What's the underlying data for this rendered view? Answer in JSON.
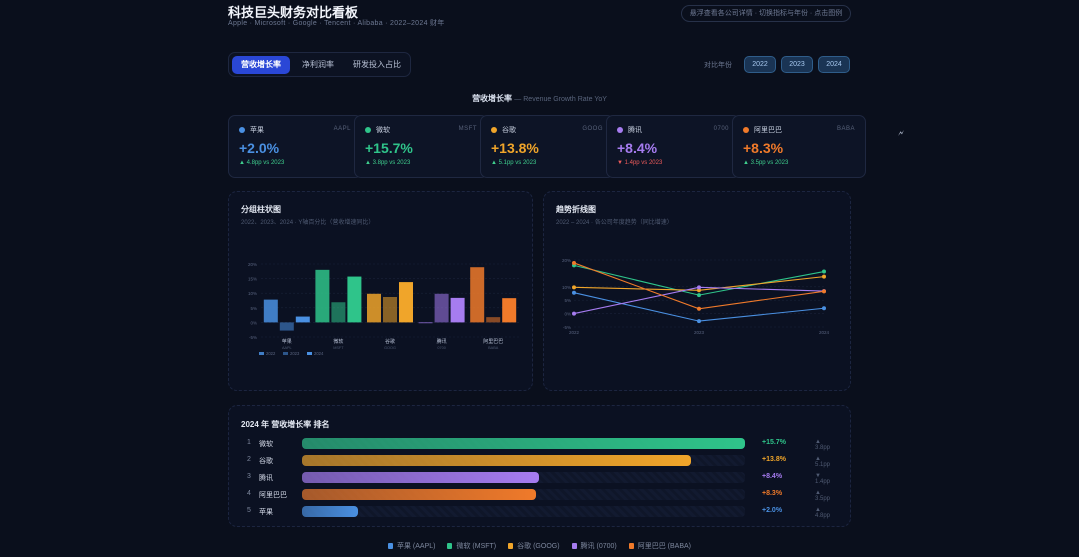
{
  "header": {
    "title": "科技巨头财务对比看板",
    "subtitle": "Apple · Microsoft · Google · Tencent · Alibaba · 2022–2024 财年",
    "hint": "悬浮查看各公司详情 · 切换指标与年份 · 点击图例"
  },
  "tabs": [
    {
      "label": "营收增长率",
      "active": true
    },
    {
      "label": "净利润率",
      "active": false
    },
    {
      "label": "研发投入占比",
      "active": false
    }
  ],
  "year_filter": {
    "label": "对比年份",
    "years": [
      "2022",
      "2023",
      "2024"
    ]
  },
  "section": {
    "title": "营收增长率",
    "subtitle": "— Revenue Growth Rate YoY"
  },
  "cards": [
    {
      "name": "苹果",
      "ticker": "AAPL",
      "value": "+2.0%",
      "delta": "▲ 4.8pp vs 2023",
      "color": "#4a90e2",
      "delta_color": "#3fcf8e"
    },
    {
      "name": "微软",
      "ticker": "MSFT",
      "value": "+15.7%",
      "delta": "▲ 3.8pp vs 2023",
      "color": "#2fc48a",
      "delta_color": "#3fcf8e"
    },
    {
      "name": "谷歌",
      "ticker": "GOOG",
      "value": "+13.8%",
      "delta": "▲ 5.1pp vs 2023",
      "color": "#f0a52a",
      "delta_color": "#3fcf8e"
    },
    {
      "name": "腾讯",
      "ticker": "0700",
      "value": "+8.4%",
      "delta": "▼ 1.4pp vs 2023",
      "color": "#a67cf0",
      "delta_color": "#ef5b5b"
    },
    {
      "name": "阿里巴巴",
      "ticker": "BABA",
      "value": "+8.3%",
      "delta": "▲ 3.5pp vs 2023",
      "color": "#f07a2a",
      "delta_color": "#3fcf8e"
    }
  ],
  "bar_panel": {
    "title": "分组柱状图",
    "subtitle": "2022、2023、2024 · Y轴百分比（营收增速同比）"
  },
  "line_panel": {
    "title": "趋势折线图",
    "subtitle": "2022 – 2024 · 各公司年度趋势（同比增速）"
  },
  "chart_data": [
    {
      "type": "bar",
      "categories": [
        "苹果",
        "微软",
        "谷歌",
        "腾讯",
        "阿里巴巴"
      ],
      "category_sub": [
        "AAPL",
        "MSFT",
        "GOOG",
        "0700",
        "BABA"
      ],
      "series": [
        {
          "name": "2022",
          "values": [
            7.8,
            18.0,
            9.8,
            0.0,
            18.9
          ]
        },
        {
          "name": "2023",
          "values": [
            -2.8,
            6.9,
            8.7,
            9.8,
            1.8
          ]
        },
        {
          "name": "2024",
          "values": [
            2.0,
            15.7,
            13.8,
            8.4,
            8.3
          ]
        }
      ],
      "ylim": [
        -5,
        20
      ],
      "yticks": [
        "20%",
        "15%",
        "10%",
        "5%",
        "0%",
        "-5%"
      ],
      "legend": [
        "2022",
        "2023",
        "2024"
      ]
    },
    {
      "type": "line",
      "x": [
        "2022",
        "2023",
        "2024"
      ],
      "series": [
        {
          "name": "苹果",
          "values": [
            7.8,
            -2.8,
            2.0
          ]
        },
        {
          "name": "微软",
          "values": [
            18.0,
            6.9,
            15.7
          ]
        },
        {
          "name": "谷歌",
          "values": [
            9.8,
            8.7,
            13.8
          ]
        },
        {
          "name": "腾讯",
          "values": [
            0.0,
            9.8,
            8.4
          ]
        },
        {
          "name": "阿里巴巴",
          "values": [
            18.9,
            1.8,
            8.3
          ]
        }
      ],
      "ylim": [
        -5,
        20
      ],
      "yticks": [
        "20%",
        "10%",
        "5%",
        "0%",
        "-5%"
      ]
    }
  ],
  "ranking": {
    "title": "2024 年 营收增长率 排名",
    "max_value": 15.7,
    "rows": [
      {
        "rank": "1",
        "name": "微软",
        "value": 15.7,
        "label": "+15.7%",
        "delta": "▲ 3.8pp",
        "color": "#2fc48a"
      },
      {
        "rank": "2",
        "name": "谷歌",
        "value": 13.8,
        "label": "+13.8%",
        "delta": "▲ 5.1pp",
        "color": "#f0a52a"
      },
      {
        "rank": "3",
        "name": "腾讯",
        "value": 8.4,
        "label": "+8.4%",
        "delta": "▼ 1.4pp",
        "color": "#a67cf0"
      },
      {
        "rank": "4",
        "name": "阿里巴巴",
        "value": 8.3,
        "label": "+8.3%",
        "delta": "▲ 3.5pp",
        "color": "#f07a2a"
      },
      {
        "rank": "5",
        "name": "苹果",
        "value": 2.0,
        "label": "+2.0%",
        "delta": "▲ 4.8pp",
        "color": "#4a90e2"
      }
    ]
  },
  "legend": [
    {
      "label": "苹果 (AAPL)",
      "color": "#4a90e2"
    },
    {
      "label": "微软 (MSFT)",
      "color": "#2fc48a"
    },
    {
      "label": "谷歌 (GOOG)",
      "color": "#f0a52a"
    },
    {
      "label": "腾讯 (0700)",
      "color": "#a67cf0"
    },
    {
      "label": "阿里巴巴 (BABA)",
      "color": "#f07a2a"
    }
  ],
  "cursor_icon": "pointer-cursor-icon"
}
